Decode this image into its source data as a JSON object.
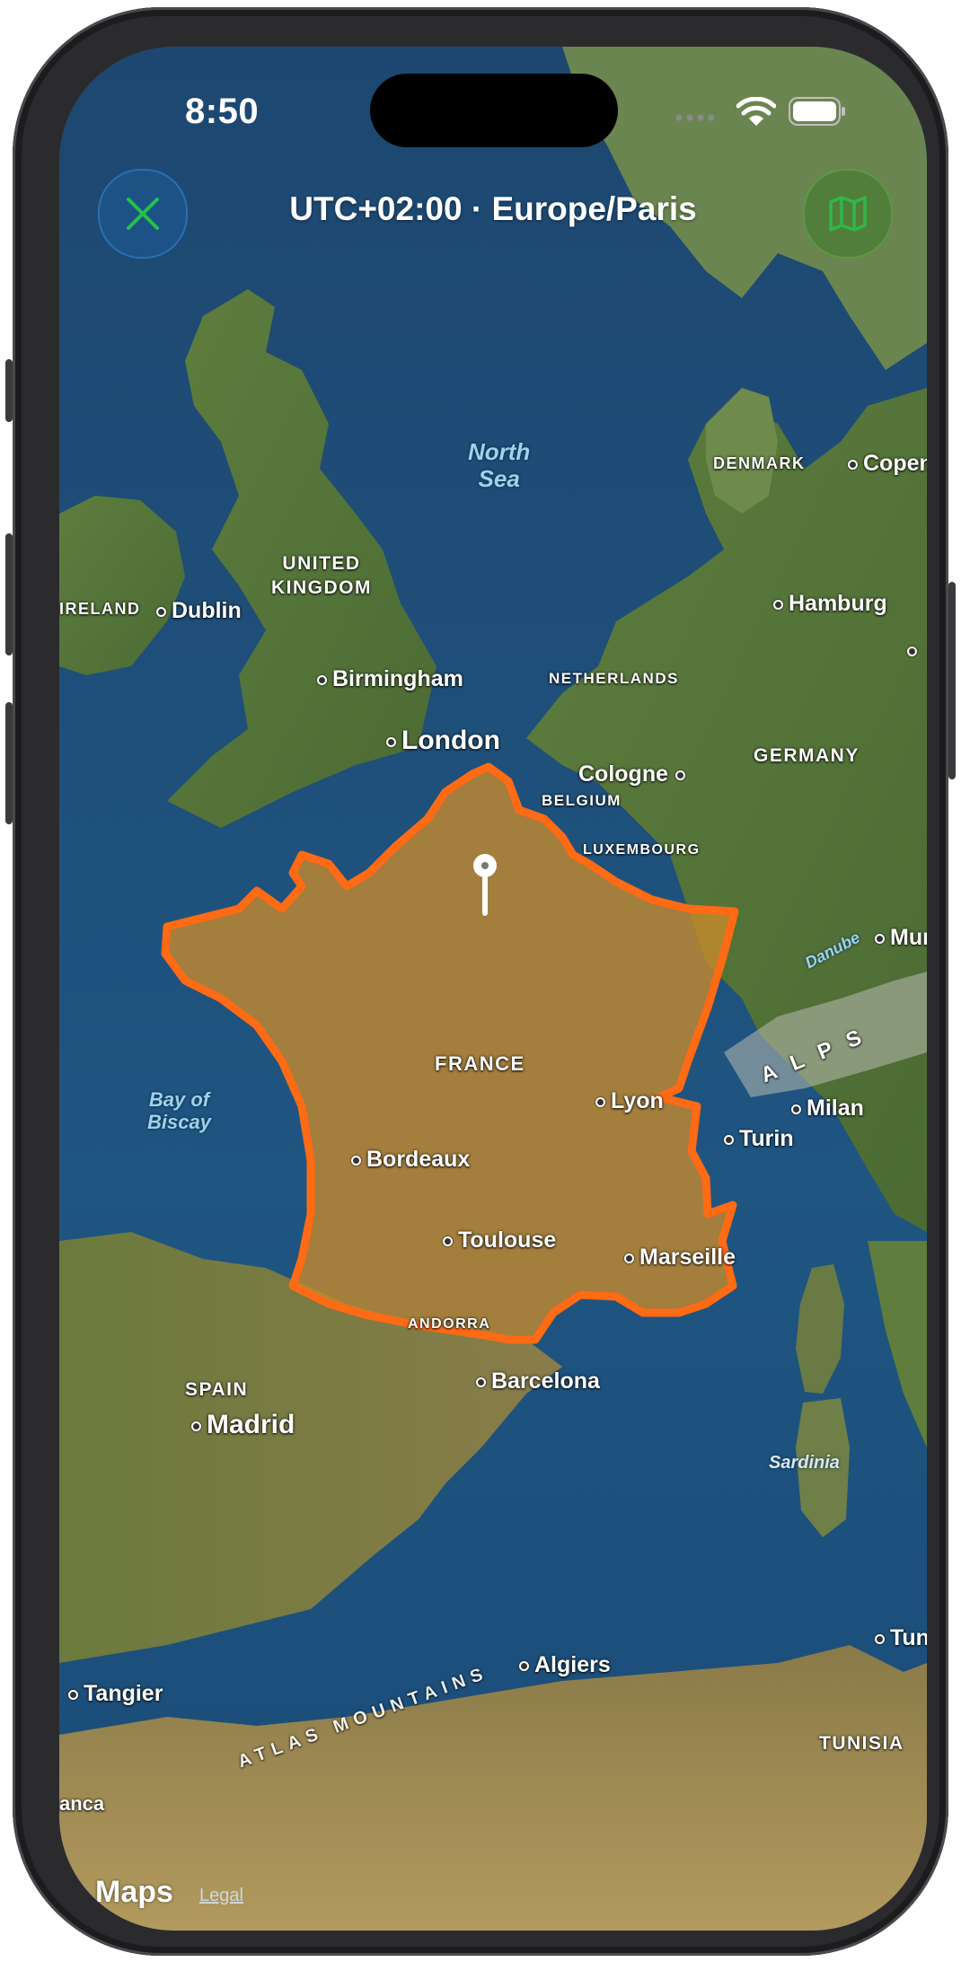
{
  "status_bar": {
    "time": "8:50"
  },
  "header": {
    "title": "UTC+02:00 · Europe/Paris"
  },
  "buttons": {
    "close": "close-icon",
    "map_mode": "map-icon"
  },
  "colors": {
    "highlight": "#ff6a14",
    "close_accent": "#22c24a",
    "map_accent": "#2fb84a"
  },
  "map": {
    "labels": {
      "north_sea": "North\nSea",
      "bay_of_biscay": "Bay of\nBiscay",
      "danube": "Danube",
      "alps": "A L P S",
      "sardinia": "Sardinia",
      "atlas": "ATLAS MOUNTAINS",
      "denmark": "DENMARK",
      "ireland": "IRELAND",
      "uk": "UNITED\nKINGDOM",
      "netherlands": "NETHERLANDS",
      "germany": "GERMANY",
      "belgium": "BELGIUM",
      "luxembourg": "LUXEMBOURG",
      "france": "FRANCE",
      "andorra": "ANDORRA",
      "spain": "SPAIN",
      "tunisia": "TUNISIA"
    },
    "cities": {
      "dublin": "Dublin",
      "birmingham": "Birmingham",
      "london": "London",
      "copenhagen": "Copen",
      "hamburg": "Hamburg",
      "cologne": "Cologne",
      "munich": "Mur",
      "lyon": "Lyon",
      "milan": "Milan",
      "turin": "Turin",
      "bordeaux": "Bordeaux",
      "toulouse": "Toulouse",
      "marseille": "Marseille",
      "barcelona": "Barcelona",
      "madrid": "Madrid",
      "algiers": "Algiers",
      "tangier": "Tangier",
      "tunis": "Tuni",
      "casablanca": "anca"
    },
    "highlighted_country": "FRANCE",
    "pin_icon": "location-pin-icon"
  },
  "attribution": {
    "logo": "Maps",
    "legal": "Legal"
  }
}
